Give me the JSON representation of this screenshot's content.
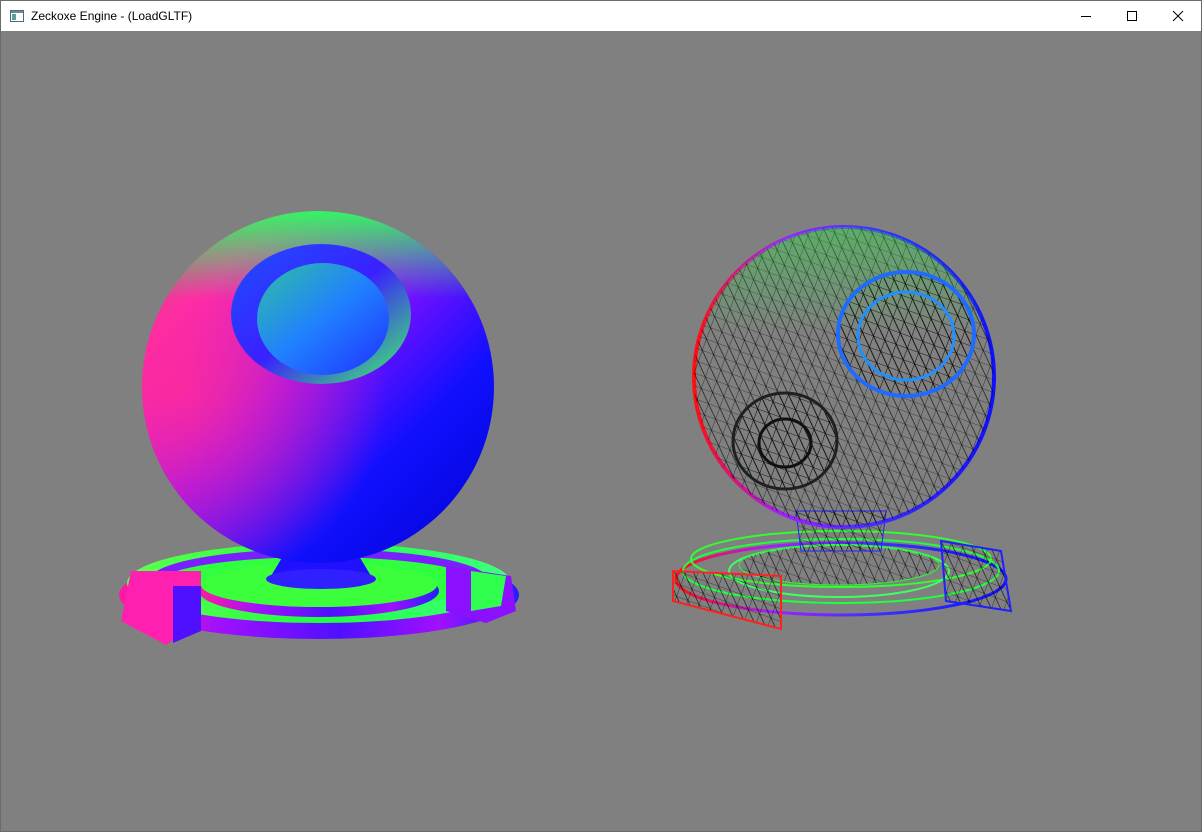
{
  "window": {
    "title": "Zeckoxe Engine - (LoadGLTF)",
    "icon": "app-window-icon",
    "buttons": [
      "minimize",
      "maximize",
      "close"
    ]
  },
  "viewport": {
    "background": "#808080",
    "objects": [
      {
        "name": "material-ball-shaded",
        "render_mode": "normal-colored solid"
      },
      {
        "name": "material-ball-wireframe",
        "render_mode": "normal-colored wireframe"
      }
    ]
  }
}
